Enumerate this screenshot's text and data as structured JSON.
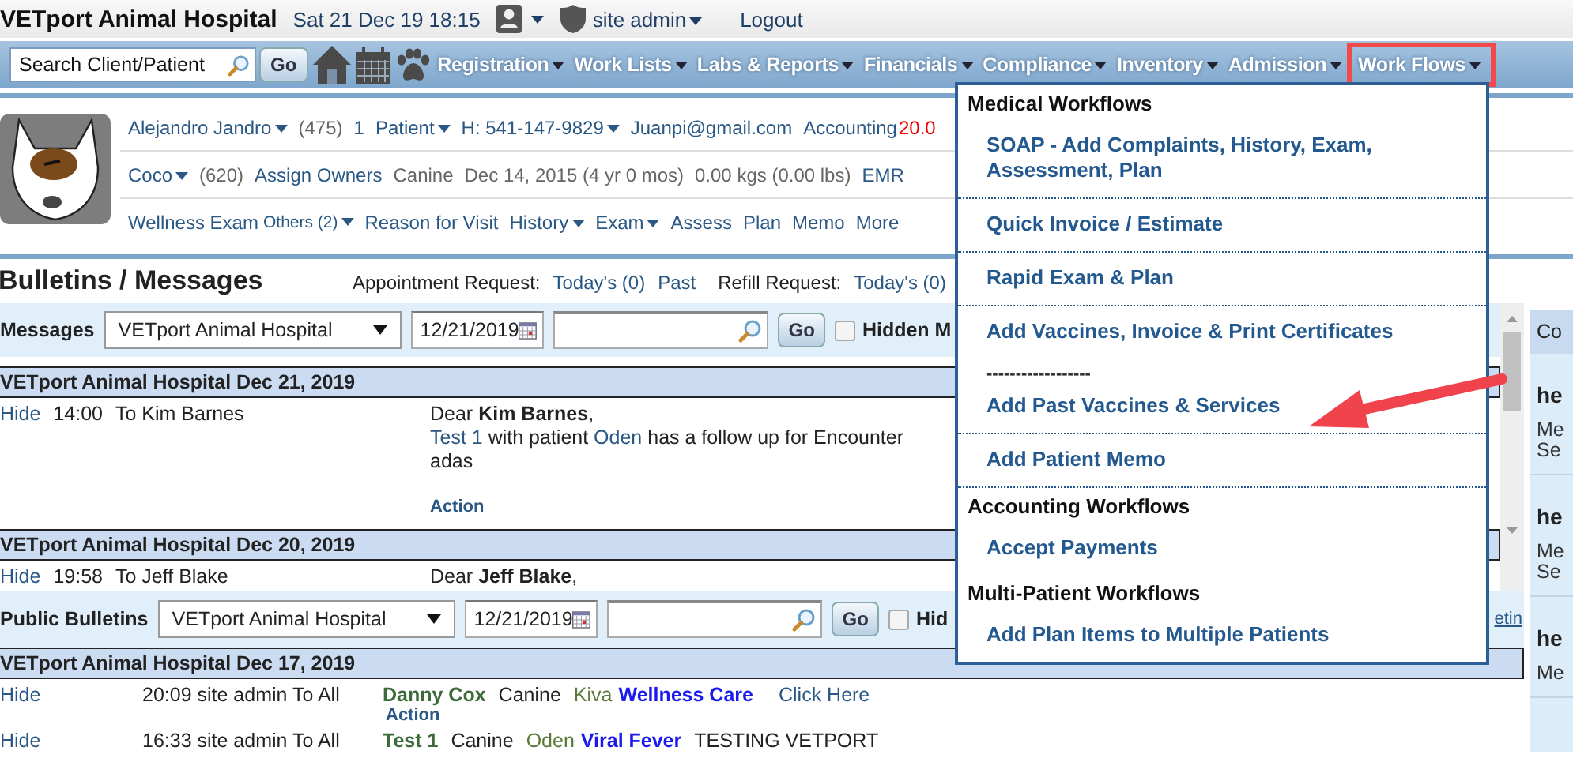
{
  "header": {
    "title": "VETport Animal Hospital",
    "datetime": "Sat 21 Dec 19 18:15",
    "user": "site admin",
    "logout": "Logout"
  },
  "nav": {
    "search_placeholder": "Search Client/Patient",
    "go": "Go",
    "menus": [
      {
        "label": "Registration",
        "highlighted": false
      },
      {
        "label": "Work Lists",
        "highlighted": false
      },
      {
        "label": "Labs & Reports",
        "highlighted": false
      },
      {
        "label": "Financials",
        "highlighted": false
      },
      {
        "label": "Compliance",
        "highlighted": false
      },
      {
        "label": "Inventory",
        "highlighted": false
      },
      {
        "label": "Admission",
        "highlighted": false
      },
      {
        "label": "Work Flows",
        "highlighted": true
      }
    ]
  },
  "patient": {
    "owner_line": [
      {
        "text": "Alejandro Jandro",
        "kind": "menu"
      },
      {
        "text": "(475)",
        "kind": "muted"
      },
      {
        "text": "1",
        "kind": "link"
      },
      {
        "text": "Patient",
        "kind": "menu"
      },
      {
        "text": "H: 541-147-9829",
        "kind": "menu"
      },
      {
        "text": "Juanpi@gmail.com",
        "kind": "link"
      },
      {
        "text": "Accounting",
        "kind": "link"
      },
      {
        "text": "20.0",
        "kind": "alert"
      }
    ],
    "pet_line": [
      {
        "text": "Coco",
        "kind": "menu"
      },
      {
        "text": "(620)",
        "kind": "muted"
      },
      {
        "text": "Assign Owners",
        "kind": "link"
      },
      {
        "text": "Canine",
        "kind": "muted"
      },
      {
        "text": "Dec 14, 2015 (4 yr 0 mos)",
        "kind": "muted"
      },
      {
        "text": "0.00 kgs (0.00 lbs)",
        "kind": "muted"
      },
      {
        "text": "EMR",
        "kind": "link"
      }
    ],
    "visit_line": [
      {
        "text": "Wellness Exam",
        "kind": "link"
      },
      {
        "text": "Others (2)",
        "kind": "small-menu"
      },
      {
        "text": "Reason for Visit",
        "kind": "link"
      },
      {
        "text": "History",
        "kind": "menu"
      },
      {
        "text": "Exam",
        "kind": "menu"
      },
      {
        "text": "Assess",
        "kind": "link"
      },
      {
        "text": "Plan",
        "kind": "link"
      },
      {
        "text": "Memo",
        "kind": "link"
      },
      {
        "text": "More",
        "kind": "link"
      }
    ]
  },
  "bulletins": {
    "title": "Bulletins / Messages",
    "requests": [
      {
        "text": "Appointment Request:",
        "kind": "label"
      },
      {
        "text": "Today's (0)",
        "kind": "link"
      },
      {
        "text": "Past",
        "kind": "link"
      },
      {
        "text": "Refill Request:",
        "kind": "label"
      },
      {
        "text": "Today's (0)",
        "kind": "link"
      }
    ]
  },
  "messages": {
    "filter": {
      "label": "Messages",
      "select": "VETport Animal Hospital",
      "date": "12/21/2019",
      "go": "Go",
      "checkbox_label": "Hidden M",
      "checked": false
    },
    "groups": [
      {
        "heading": "VETport Animal Hospital  Dec 21, 2019",
        "rows": [
          {
            "hide": "Hide",
            "time": "14:00",
            "to": "To Kim Barnes",
            "body": [
              [
                {
                  "text": "Dear ",
                  "kind": "text"
                },
                {
                  "text": "Kim Barnes",
                  "kind": "bold"
                },
                {
                  "text": ",",
                  "kind": "text"
                }
              ],
              [
                {
                  "text": "Test 1",
                  "kind": "link"
                },
                {
                  "text": " with patient ",
                  "kind": "text"
                },
                {
                  "text": "Oden",
                  "kind": "link"
                },
                {
                  "text": " has a follow up for Encounter",
                  "kind": "text"
                }
              ],
              [
                {
                  "text": "adas",
                  "kind": "text"
                }
              ]
            ],
            "action": "Action"
          }
        ]
      },
      {
        "heading": "VETport Animal Hospital  Dec 20, 2019",
        "rows": [
          {
            "hide": "Hide",
            "time": "19:58",
            "to": "To Jeff Blake",
            "body": [
              [
                {
                  "text": "Dear ",
                  "kind": "text"
                },
                {
                  "text": "Jeff Blake",
                  "kind": "bold"
                },
                {
                  "text": ",",
                  "kind": "text"
                }
              ]
            ]
          }
        ]
      }
    ]
  },
  "public_bulletins": {
    "filter": {
      "label": "Public Bulletins",
      "select": "VETport Animal Hospital",
      "date": "12/21/2019",
      "go": "Go",
      "checkbox_label": "Hid",
      "checked": false,
      "link": "etin"
    },
    "groups": [
      {
        "heading": "VETport Animal Hospital  Dec 17, 2019",
        "rows": [
          {
            "hide": "Hide",
            "posted": "20:09 site admin To All",
            "author": "Danny Cox",
            "species": "Canine",
            "patient": "Kiva",
            "subject": "Wellness Care",
            "extra": {
              "text": "Click Here",
              "kind": "link"
            },
            "action": "Action"
          },
          {
            "hide": "Hide",
            "posted": "16:33 site admin To All",
            "author": "Test 1",
            "species": "Canine",
            "patient": "Oden",
            "subject": "Viral Fever",
            "extra": {
              "text": "TESTING VETPORT",
              "kind": "plain"
            }
          }
        ]
      }
    ]
  },
  "side_panel": {
    "title": "Co",
    "entries": [
      {
        "title": "he",
        "lines": [
          "Me",
          "Se"
        ]
      },
      {
        "title": "he",
        "lines": [
          "Me",
          "Se"
        ]
      },
      {
        "title": "he",
        "lines": [
          "Me"
        ]
      }
    ]
  },
  "workflow_menu": {
    "sections": [
      {
        "title": "Medical Workflows",
        "items": [
          {
            "label": "SOAP - Add Complaints, History, Exam, Assessment, Plan",
            "kind": "item",
            "pointed": false
          },
          {
            "label": "Quick Invoice / Estimate",
            "kind": "item",
            "pointed": false
          },
          {
            "label": "Rapid Exam & Plan",
            "kind": "item",
            "pointed": false
          },
          {
            "label": "Add Vaccines, Invoice & Print Certificates",
            "kind": "item",
            "pointed": false
          },
          {
            "label": "------------------",
            "kind": "separator"
          },
          {
            "label": "Add Past Vaccines & Services",
            "kind": "item",
            "pointed": true
          },
          {
            "label": "Add Patient Memo",
            "kind": "item",
            "pointed": false
          }
        ]
      },
      {
        "title": "Accounting Workflows",
        "items": [
          {
            "label": "Accept Payments",
            "kind": "item",
            "pointed": false
          }
        ]
      },
      {
        "title": "Multi-Patient Workflows",
        "items": [
          {
            "label": "Add Plan Items to Multiple Patients",
            "kind": "item",
            "pointed": false
          }
        ]
      }
    ]
  }
}
